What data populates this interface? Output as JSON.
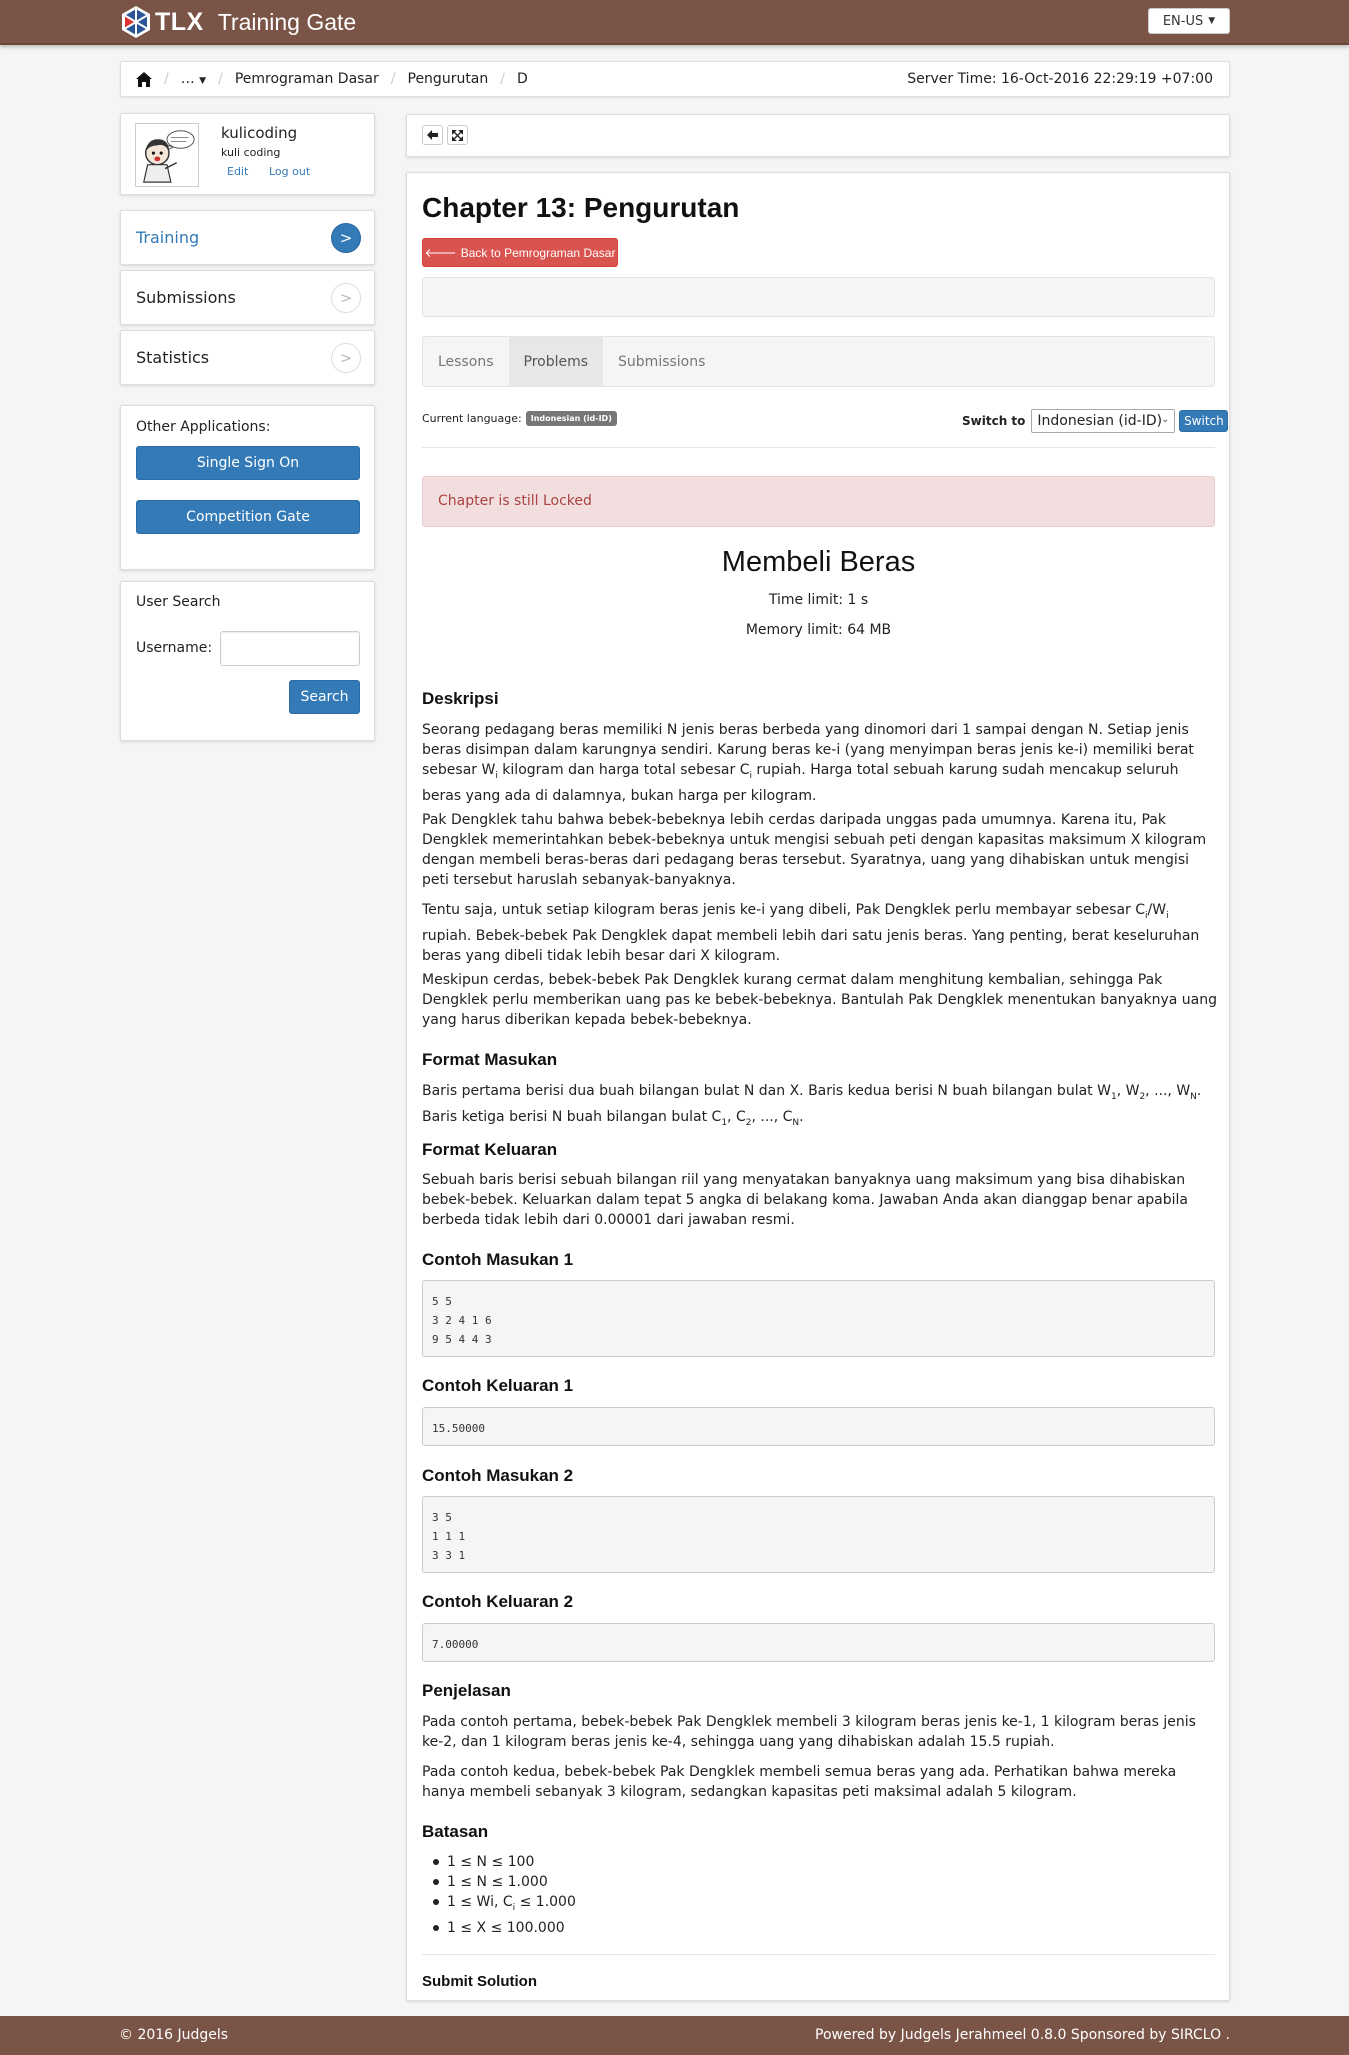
{
  "header": {
    "brand_short": "TLX",
    "app_name": "Training Gate",
    "language": "EN-US"
  },
  "breadcrumb": {
    "items": [
      "…",
      "Pemrograman Dasar",
      "Pengurutan",
      "D"
    ],
    "server_time": "Server Time: 16-Oct-2016 22:29:19 +07:00"
  },
  "profile": {
    "username": "kulicoding",
    "fullname": "kuli coding",
    "edit": "Edit",
    "logout": "Log out"
  },
  "sidebar": {
    "menu": [
      {
        "label": "Training",
        "arrow": ">",
        "active": true
      },
      {
        "label": "Submissions",
        "arrow": ">",
        "active": false
      },
      {
        "label": "Statistics",
        "arrow": ">",
        "active": false
      }
    ],
    "other_apps_title": "Other Applications:",
    "other_apps": [
      "Single Sign On",
      "Competition Gate"
    ],
    "user_search": {
      "title": "User Search",
      "username_label": "Username:",
      "username_value": "",
      "search_button": "Search"
    }
  },
  "main": {
    "chapter_title": "Chapter 13: Pengurutan",
    "back_button": "Back to Pemrograman Dasar",
    "tabs": [
      "Lessons",
      "Problems",
      "Submissions"
    ],
    "active_tab": "Problems",
    "current_language_label": "Current language:",
    "current_language": "Indonesian (id-ID)",
    "switch_label": "Switch to",
    "switch_value": "Indonesian (id-ID)",
    "switch_button": "Switch",
    "alert": "Chapter is still Locked"
  },
  "problem": {
    "title": "Membeli Beras",
    "time_limit": "Time limit: 1 s",
    "memory_limit": "Memory limit: 64 MB",
    "sections": {
      "deskripsi": "Deskripsi",
      "format_masukan": "Format Masukan",
      "format_keluaran": "Format Keluaran",
      "contoh_masukan_1": "Contoh Masukan 1",
      "contoh_keluaran_1": "Contoh Keluaran 1",
      "contoh_masukan_2": "Contoh Masukan 2",
      "contoh_keluaran_2": "Contoh Keluaran 2",
      "penjelasan": "Penjelasan",
      "batasan": "Batasan",
      "submit": "Submit Solution"
    },
    "desc_p2": "Pak Dengklek tahu bahwa bebek-bebeknya lebih cerdas daripada unggas pada umumnya. Karena itu, Pak Dengklek memerintahkan bebek-bebeknya untuk mengisi sebuah peti dengan kapasitas maksimum X kilogram dengan membeli beras-beras dari pedagang beras tersebut. Syaratnya, uang yang dihabiskan untuk mengisi peti tersebut haruslah sebanyak-banyaknya.",
    "desc_p4": "Meskipun cerdas, bebek-bebek Pak Dengklek kurang cermat dalam menghitung kembalian, sehingga Pak Dengklek perlu memberikan uang pas ke bebek-bebeknya. Bantulah Pak Dengklek menentukan banyaknya uang yang harus diberikan kepada bebek-bebeknya.",
    "format_keluaran_text": "Sebuah baris berisi sebuah bilangan riil yang menyatakan banyaknya uang maksimum yang bisa dihabiskan bebek-bebek. Keluarkan dalam tepat 5 angka di belakang koma. Jawaban Anda akan dianggap benar apabila berbeda tidak lebih dari 0.00001 dari jawaban resmi.",
    "sample_in_1": [
      "5 5",
      "3 2 4 1 6",
      "9 5 4 4 3"
    ],
    "sample_out_1": "15.50000",
    "sample_in_2": [
      "3 5",
      "1 1 1",
      "3 3 1"
    ],
    "sample_out_2": "7.00000",
    "penjelasan_p1": "Pada contoh pertama, bebek-bebek Pak Dengklek membeli 3 kilogram beras jenis ke-1, 1 kilogram beras jenis ke-2, dan 1 kilogram beras jenis ke-4, sehingga uang yang dihabiskan adalah 15.5 rupiah.",
    "penjelasan_p2": "Pada contoh kedua, bebek-bebek Pak Dengklek membeli semua beras yang ada. Perhatikan bahwa mereka hanya membeli sebanyak 3 kilogram, sedangkan kapasitas peti maksimal adalah 5 kilogram.",
    "batasan_1": "1 ≤ N ≤ 100",
    "batasan_2": "1 ≤ N ≤ 1.000",
    "batasan_4": "1 ≤ X ≤ 100.000"
  },
  "footer": {
    "copyright": "© 2016 Judgels",
    "powered": "Powered by Judgels Jerahmeel 0.8.0 Sponsored by SIRCLO ."
  },
  "colors": {
    "brand": "#7a5447",
    "primary": "#337ab7",
    "danger": "#d9534f",
    "alert_bg": "#f2dede"
  }
}
